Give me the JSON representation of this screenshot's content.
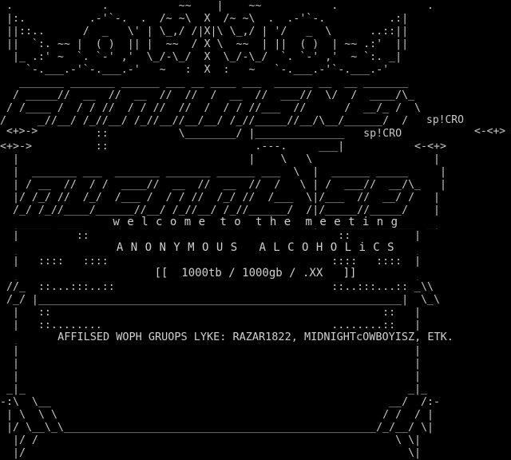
{
  "art": {
    "lines": [
      " .              .           ~~    |    ~~           .              . ",
      " |:.          .-'`-.  .  /~ ~\\  X  /~ ~\\  .  .-'`-.          .:| ",
      " ||::..      /  _   \\' | \\_,/ /|X|\\ \\_,/ | '/   _  \\      ..::|| ",
      " ||  `:. ~~ |  ( )  || |  ~~  / X \\  ~~  | ||  ( )  | ~~ .:'  || ",
      "  |_ .:' ~  `. `-' ,'  \\_/-\\_/  X  \\_/-\\_/  `. `-' ,'  ~ `:. _| ",
      "    `-.___.-'`-.___.-'   ~   :  X  :   ~   `-.___.-'`-.___.-'    ",
      "   _______ _______ ______ ___ __ ____ ___  ______ __  __ _______ ",
      "  / _____//  __  //  __  //  //  /  __  //  ___//  \\/  /  ____/\\_",
      " / /____ /  / / //  / / //  //  /  / / //___  //      /  __/_ /  \\",
      "/______//__/ /_//__/ /_//__//__/__/ /_//_____//__/\\__/______/  /  ",
      "               ::           \\________/ |______________   sp!CRO  ",
      "<+>->          ::                       .---.     ___|           <-<+>",
      "  |                                    |    \\   \\                   | ",
      "  |  _______ ___  _______ _______ ______ ___  \\  |  ______ _____     | ",
      "  | / __  //  / /  ____//  __  //  __  //  /   \\ | /  ___//  __/\\_   | ",
      "  |/ /_/ //  /_/  /___ /  / / //  /_/ //  /___  \\|/___  //  __/ /   | ",
      "  /_/ /_//____/______//__/ /_//__/ /_//______/  /|/_____//_____/    | ",
      "  |_____.____                                    |  .______._____. _| ",
      "  |         ::                                       ::          |  ",
      "  |     ::....::                                     ::....::    |  ",
      "  |   ::::   ::::                                   ::::   ::::  |  ",
      "  |   ::  ::::  ::                                  ::  ::::  :: |  ",
      " //_  ::...:::..::                                  ::..:::...:: _\\\\ ",
      " /_/ |_________________________________________________________|  \\_\\ ",
      "  |   ::                                                    ::   |  ",
      "  |   ::........                                    ........::   |  ",
      "  |                                                              |  ",
      "  |                                                              |  ",
      "  |                                                              |  ",
      "  |                                                              |  ",
      " _|_                                                            _|_ ",
      "-:\\  \\__                                                     __/  /:-",
      " | \\  \\ \\                                                   / /  / | ",
      " |/ \\__\\_\\_________________________________________________/_/__/ \\| ",
      "  |/ /                                                        \\ \\| ",
      "  |/                                                            \\| "
    ]
  },
  "header": {
    "credit": "sp!CRO",
    "nav_left": "<+>->",
    "nav_right": "<-<+>"
  },
  "body": {
    "welcome": "w e l c o m e  t o  t h e  m e e t i n g",
    "group_name": "A N O N Y M O U S   A L C O H O L i C S",
    "sizes": "[[  1000tb / 1000gb / .XX   ]]",
    "affiliates": "AFFILSED WOPH GRUOPS LYKE: RAZAR1822, MIDNIGHTcOWBOYISZ, ETK."
  },
  "colors": {
    "background": "#000000",
    "foreground": "#c8c8c8"
  }
}
